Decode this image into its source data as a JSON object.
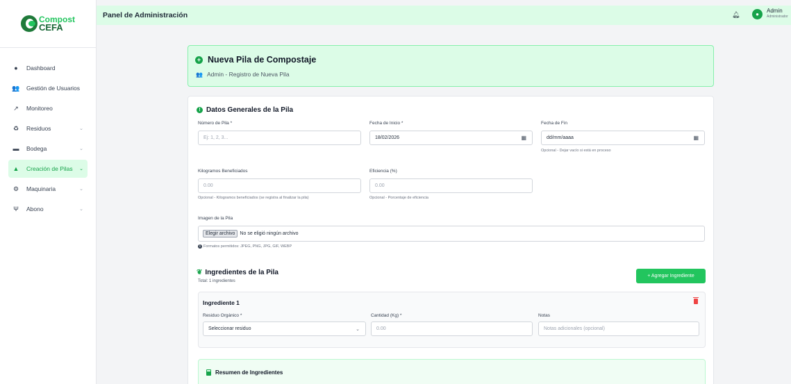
{
  "sidebar": {
    "logo": {
      "line1": "Compost",
      "line2": "CEFA"
    },
    "items": [
      {
        "label": "Dashboard",
        "icon": "palette-icon"
      },
      {
        "label": "Gestión de Usuarios",
        "icon": "users-icon"
      },
      {
        "label": "Monitoreo",
        "icon": "chart-line-icon"
      },
      {
        "label": "Residuos",
        "icon": "recycle-icon"
      },
      {
        "label": "Bodega",
        "icon": "warehouse-icon"
      },
      {
        "label": "Creación de Pilas",
        "icon": "mountain-icon"
      },
      {
        "label": "Maquinaria",
        "icon": "cogs-icon"
      },
      {
        "label": "Abono",
        "icon": "seedling-icon"
      }
    ],
    "active_index": 5
  },
  "header": {
    "title": "Panel de Administración",
    "user_name": "Admin",
    "user_role": "Administrador"
  },
  "title_card": {
    "title": "Nueva Pila de Compostaje",
    "subtitle": "Admin - Registro de Nueva Pila"
  },
  "general": {
    "section_title": "Datos Generales de la Pila",
    "numero": {
      "label": "Número de Pila *",
      "placeholder": "Ej: 1, 2, 3..."
    },
    "fecha_inicio": {
      "label": "Fecha de Inicio *",
      "value": "18/02/2026"
    },
    "fecha_fin": {
      "label": "Fecha de Fin",
      "value": "dd/mm/aaaa",
      "help": "Opcional - Dejar vacío si está en proceso"
    },
    "kilogramos": {
      "label": "Kilogramos Beneficiados",
      "placeholder": "0.00",
      "help": "Opcional - Kilogramos beneficiados (se registra al finalizar la pila)"
    },
    "eficiencia": {
      "label": "Eficiencia (%)",
      "placeholder": "0.00",
      "help": "Opcional - Porcentaje de eficiencia"
    },
    "imagen": {
      "label": "Imagen de la Pila",
      "button": "Elegir archivo",
      "status": "No se eligió ningún archivo",
      "help": "Formatos permitidos: JPEG, PNG, JPG, GIF, WEBP"
    }
  },
  "ingredients": {
    "section_title": "Ingredientes de la Pila",
    "total": "Total: 1 ingredientes",
    "add_button": "+ Agregar Ingrediente",
    "items": [
      {
        "title": "Ingrediente 1",
        "residuo_label": "Residuo Orgánico *",
        "residuo_value": "Seleccionar residuo",
        "cantidad_label": "Cantidad (Kg) *",
        "cantidad_placeholder": "0.00",
        "notas_label": "Notas",
        "notas_placeholder": "Notas adicionales (opcional)"
      }
    ]
  },
  "summary": {
    "title": "Resumen de Ingredientes"
  },
  "colors": {
    "accent": "#22c55e",
    "accent_dark": "#16a34a",
    "header_bg": "#dcfce7",
    "danger": "#ef4444"
  }
}
